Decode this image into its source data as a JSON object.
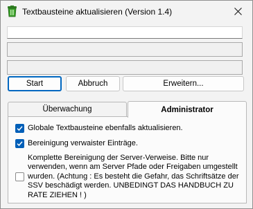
{
  "window": {
    "title": "Textbausteine aktualisieren (Version 1.4)",
    "app_icon": "recycle-bin-icon",
    "close_icon": "close-icon"
  },
  "fields": {
    "text_input": "",
    "status_1": "",
    "status_2": ""
  },
  "buttons": {
    "start": "Start",
    "abbruch": "Abbruch",
    "erweitern": "Erweitern..."
  },
  "tabs": [
    {
      "label": "Überwachung",
      "selected": false
    },
    {
      "label": "Administrator",
      "selected": true
    }
  ],
  "options": [
    {
      "label": "Globale Textbausteine ebenfalls aktualisieren.",
      "checked": true
    },
    {
      "label": "Bereinigung verwaister Einträge.",
      "checked": true
    },
    {
      "label": "Komplette Bereinigung der Server-Verweise. Bitte nur verwenden, wenn am Server Pfade oder Freigaben umgestellt wurden. (Achtung : Es besteht die Gefahr, das Schriftsätze der SSV beschädigt werden. UNBEDINGT DAS HANDBUCH ZU RATE ZIEHEN ! )",
      "checked": false
    }
  ],
  "colors": {
    "accent": "#005fb8",
    "icon_green": "#3aa02a"
  }
}
